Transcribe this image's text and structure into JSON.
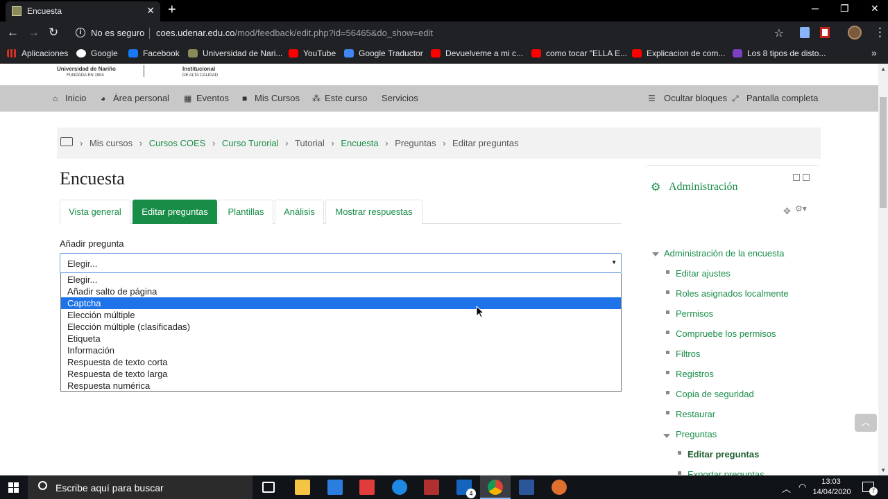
{
  "browser": {
    "tab_title": "Encuesta",
    "tab_close": "✕",
    "new_tab": "+",
    "window_min": "─",
    "window_max": "❐",
    "window_close": "✕",
    "insecure_label": "No es seguro",
    "url_host": "coes.udenar.edu.co",
    "url_path": "/mod/feedback/edit.php?id=56465&do_show=edit",
    "bookmarks": [
      {
        "label": "Aplicaciones",
        "color": "#d93025"
      },
      {
        "label": "Google",
        "color": "#4285f4"
      },
      {
        "label": "Facebook",
        "color": "#1877f2"
      },
      {
        "label": "Universidad de Nari...",
        "color": "#8a8a5a"
      },
      {
        "label": "YouTube",
        "color": "#ff0000"
      },
      {
        "label": "Google Traductor",
        "color": "#4285f4"
      },
      {
        "label": "Devuelveme a mi c...",
        "color": "#ff0000"
      },
      {
        "label": "como tocar \"ELLA E...",
        "color": "#ff0000"
      },
      {
        "label": "Explicacion de com...",
        "color": "#ff0000"
      },
      {
        "label": "Los 8 tipos de disto...",
        "color": "#7b3fbf"
      }
    ],
    "bookmarks_more": "»"
  },
  "site": {
    "logo_left_line1": "Universidad de Nariño",
    "logo_left_line2": "FUNDADA EN 1904",
    "logo_right_line1": "Institucional",
    "logo_right_line2": "DE ALTA CALIDAD"
  },
  "navbar": {
    "items": [
      "Inicio",
      "Área personal",
      "Eventos",
      "Mis Cursos",
      "Este curso",
      "Servicios"
    ],
    "hide_blocks": "Ocultar bloques",
    "fullscreen": "Pantalla completa"
  },
  "breadcrumb": {
    "items": [
      "Mis cursos",
      "Cursos COES",
      "Curso Turorial",
      "Tutorial",
      "Encuesta",
      "Preguntas",
      "Editar preguntas"
    ],
    "separator": "›"
  },
  "main": {
    "title": "Encuesta",
    "tabs": [
      "Vista general",
      "Editar preguntas",
      "Plantillas",
      "Análisis",
      "Mostrar respuestas"
    ],
    "active_tab": "Editar preguntas",
    "add_question_label": "Añadir pregunta",
    "select_value": "Elegir...",
    "select_caret": "▼",
    "options": [
      "Elegir...",
      "Añadir salto de página",
      "Captcha",
      "Elección múltiple",
      "Elección múltiple (clasificadas)",
      "Etiqueta",
      "Información",
      "Respuesta de texto corta",
      "Respuesta de texto larga",
      "Respuesta numérica"
    ],
    "highlighted_option": "Captcha"
  },
  "admin": {
    "title": "Administración",
    "tree": [
      "Administración de la encuesta",
      "Editar ajustes",
      "Roles asignados localmente",
      "Permisos",
      "Compruebe los permisos",
      "Filtros",
      "Registros",
      "Copia de seguridad",
      "Restaurar",
      "Preguntas",
      "Editar preguntas",
      "Exportar preguntas"
    ]
  },
  "taskbar": {
    "search_placeholder": "Escribe aquí para buscar",
    "time": "13:03",
    "date": "14/04/2020",
    "mail_badge": "4",
    "notif_badge": "7"
  },
  "colors": {
    "brand_green": "#188d47",
    "highlight_blue": "#1e73e8"
  }
}
